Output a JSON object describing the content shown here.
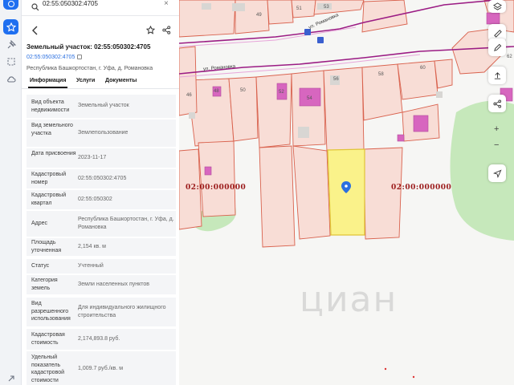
{
  "search": {
    "value": "02:55:050302:4705",
    "search_icon": "search-icon",
    "clear_icon": "close-icon"
  },
  "header": {
    "title": "Земельный участок: 02:55:050302:4705",
    "cadastral_link": "02:55:050302:4705",
    "address": "Республика Башкортостан, г. Уфа, д. Романовка"
  },
  "tabs": [
    "Информация",
    "Услуги",
    "Документы"
  ],
  "rows": [
    {
      "label": "Вид объекта недвижимости",
      "value": "Земельный участок"
    },
    {
      "label": "Вид земельного участка",
      "value": "Землепользование"
    },
    {
      "label": "Дата присвоения",
      "value": "2023-11-17"
    },
    {
      "label": "Кадастровый номер",
      "value": "02:55:050302:4705"
    },
    {
      "label": "Кадастровый квартал",
      "value": "02:55:050302"
    },
    {
      "label": "Адрес",
      "value": "Республика Башкортостан, г. Уфа, д. Романовка"
    },
    {
      "label": "Площадь уточненная",
      "value": "2,154 кв. м"
    },
    {
      "label": "Статус",
      "value": "Учтенный"
    },
    {
      "label": "Категория земель",
      "value": "Земли населенных пунктов"
    },
    {
      "label": "Вид разрешенного использования",
      "value": "Для индивидуального жилищного строительства"
    },
    {
      "label": "Кадастровая стоимость",
      "value": "2,174,893.8 руб."
    },
    {
      "label": "Удельный показатель кадастровой стоимости",
      "value": "1,009.7 руб./кв. м"
    }
  ],
  "map": {
    "zone_labels": [
      "02:00:000000",
      "02:00:000000"
    ],
    "house_numbers": [
      "49",
      "51",
      "53",
      "50",
      "52",
      "54",
      "56",
      "58",
      "60",
      "46",
      "48",
      "62"
    ],
    "streets": [
      "ул. Романовка",
      "ул. Романовка"
    ],
    "watermark": "циан",
    "zoom_in": "+",
    "zoom_out": "−",
    "colors": {
      "parcel_fill": "#f8ddd6",
      "parcel_stroke": "#d9624e",
      "selected_fill": "#faf28a",
      "selected_stroke": "#e0c437",
      "building": "#d766bf",
      "road": "#9b1c84",
      "green": "#c6e8bb"
    }
  }
}
